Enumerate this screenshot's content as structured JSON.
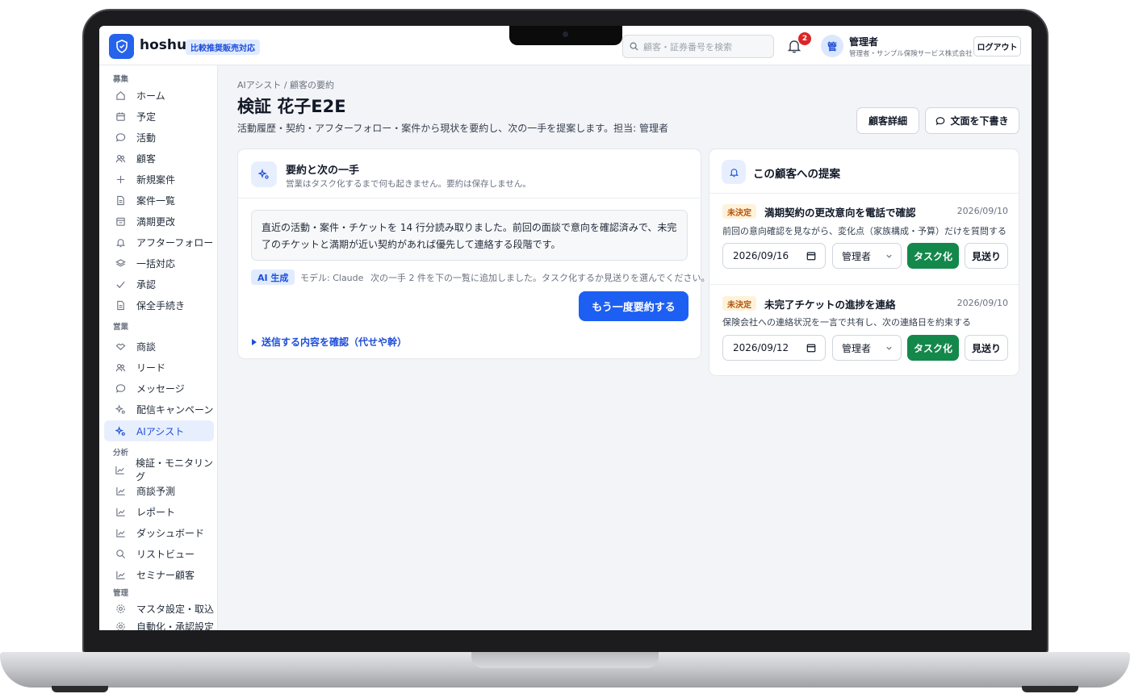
{
  "header": {
    "app_name": "hoshu",
    "badge": "比較推奨販売対応",
    "search_placeholder": "顧客・証券番号を検索",
    "notification_count": "2",
    "avatar_initial": "管",
    "user_name": "管理者",
    "user_org": "管理者・サンプル保険サービス株式会社",
    "logout_label": "ログアウト"
  },
  "sidebar": {
    "sections": [
      {
        "label": "募集",
        "items": [
          {
            "label": "ホーム",
            "icon": "home-icon"
          },
          {
            "label": "予定",
            "icon": "calendar-icon"
          },
          {
            "label": "活動",
            "icon": "chat-icon"
          },
          {
            "label": "顧客",
            "icon": "users-icon"
          },
          {
            "label": "新規案件",
            "icon": "plus-icon"
          },
          {
            "label": "案件一覧",
            "icon": "document-icon"
          },
          {
            "label": "満期更改",
            "icon": "calendar-refresh-icon"
          },
          {
            "label": "アフターフォロー",
            "icon": "bell-icon"
          },
          {
            "label": "一括対応",
            "icon": "layers-icon"
          },
          {
            "label": "承認",
            "icon": "check-icon"
          },
          {
            "label": "保全手続き",
            "icon": "document-icon"
          }
        ]
      },
      {
        "label": "営業",
        "items": [
          {
            "label": "商談",
            "icon": "handshake-icon"
          },
          {
            "label": "リード",
            "icon": "users-icon"
          },
          {
            "label": "メッセージ",
            "icon": "chat-icon"
          },
          {
            "label": "配信キャンペーン",
            "icon": "sparkle-icon"
          },
          {
            "label": "AIアシスト",
            "icon": "sparkle-icon",
            "active": true
          }
        ]
      },
      {
        "label": "分析",
        "items": [
          {
            "label": "検証・モニタリング",
            "icon": "chart-icon"
          },
          {
            "label": "商談予測",
            "icon": "chart-icon"
          },
          {
            "label": "レポート",
            "icon": "chart-icon"
          },
          {
            "label": "ダッシュボード",
            "icon": "chart-icon"
          },
          {
            "label": "リストビュー",
            "icon": "search-icon"
          },
          {
            "label": "セミナー顧客",
            "icon": "chart-icon"
          }
        ]
      },
      {
        "label": "管理",
        "items": [
          {
            "label": "マスタ設定・取込",
            "icon": "gear-icon"
          },
          {
            "label": "自動化・承認設定",
            "icon": "gear-icon"
          }
        ]
      }
    ]
  },
  "main": {
    "breadcrumb": "AIアシスト / 顧客の要約",
    "title": "検証 花子E2E",
    "description": "活動履歴・契約・アフターフォロー・案件から現状を要約し、次の一手を提案します。担当: 管理者",
    "customer_detail_label": "顧客詳細",
    "draft_label": "文面を下書き"
  },
  "summary_card": {
    "title": "要約と次の一手",
    "subtitle": "営業はタスク化するまで何も起きません。要約は保存しません。",
    "summary_text": "直近の活動・案件・チケットを 14 行分読み取りました。前回の面談で意向を確認済みで、未完了のチケットと満期が近い契約があれば優先して連絡する段階です。",
    "ai_badge": "AI 生成",
    "model_label": "モデル: Claude",
    "next_note": "次の一手 2 件を下の一覧に追加しました。タスク化するか見送りを選んでください。",
    "resummarize_label": "もう一度要約する",
    "disclosure_label": "送信する内容を確認（代せや幹）"
  },
  "suggestions_card": {
    "title": "この顧客への提案",
    "items": [
      {
        "status": "未決定",
        "title": "満期契約の更改意向を電話で確認",
        "date": "2026/09/10",
        "description": "前回の意向確認を見ながら、変化点（家族構成・予算）だけを質問する",
        "due_date": "2026/09/16",
        "assignee": "管理者",
        "task_label": "タスク化",
        "skip_label": "見送り"
      },
      {
        "status": "未決定",
        "title": "未完了チケットの進捗を連絡",
        "date": "2026/09/10",
        "description": "保険会社への連絡状況を一言で共有し、次の連絡日を約束する",
        "due_date": "2026/09/12",
        "assignee": "管理者",
        "task_label": "タスク化",
        "skip_label": "見送り"
      }
    ]
  },
  "colors": {
    "accent": "#2563eb",
    "primary_button": "#1d5ff2",
    "task_button": "#14884b",
    "notification": "#dc2626",
    "pending_tag_bg": "#fff2da",
    "pending_tag_text": "#b45309"
  }
}
